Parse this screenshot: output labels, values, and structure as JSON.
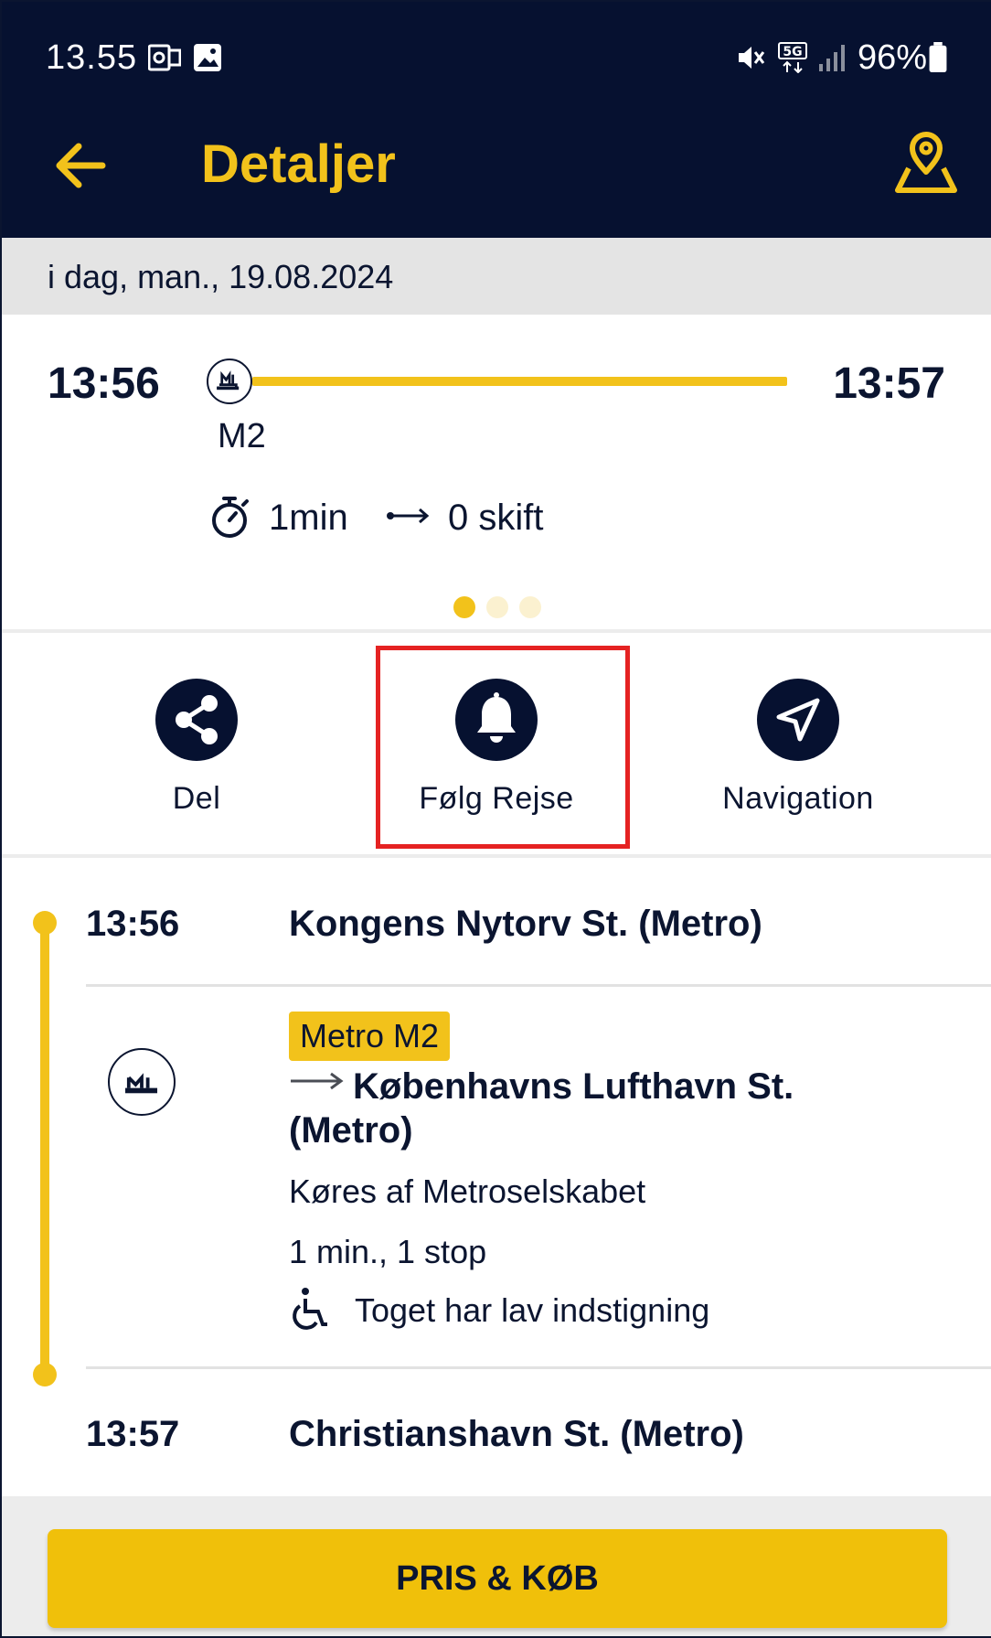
{
  "status_bar": {
    "time": "13.55",
    "battery": "96%",
    "network": "5G",
    "icons": [
      "outlook-icon",
      "gallery-icon",
      "mute-icon",
      "5g-icon",
      "signal-icon",
      "battery-icon"
    ]
  },
  "header": {
    "title": "Detaljer",
    "back_icon": "arrow-left-icon",
    "map_icon": "map-pin-icon"
  },
  "date_label": "i dag, man., 19.08.2024",
  "summary": {
    "departure": "13:56",
    "arrival": "13:57",
    "line": "M2",
    "duration": "1min",
    "changes": "0 skift",
    "page_index": 0,
    "page_count": 3
  },
  "actions": [
    {
      "label": "Del",
      "icon": "share-icon"
    },
    {
      "label": "Følg Rejse",
      "icon": "bell-icon"
    },
    {
      "label": "Navigation",
      "icon": "navigation-arrow-icon"
    }
  ],
  "itinerary": {
    "origin": {
      "time": "13:56",
      "name": "Kongens Nytorv St. (Metro)"
    },
    "leg": {
      "line": "Metro M2",
      "direction": "Københavns Lufthavn St. (Metro)",
      "operator": "Køres af Metroselskabet",
      "duration": "1 min., 1 stop",
      "accessibility": "Toget har lav indstigning"
    },
    "destination": {
      "time": "13:57",
      "name": "Christianshavn St. (Metro)"
    }
  },
  "buy_button": "PRIS & KØB",
  "colors": {
    "navy": "#061130",
    "yellow": "#f2c21b",
    "highlight": "#e52222"
  }
}
